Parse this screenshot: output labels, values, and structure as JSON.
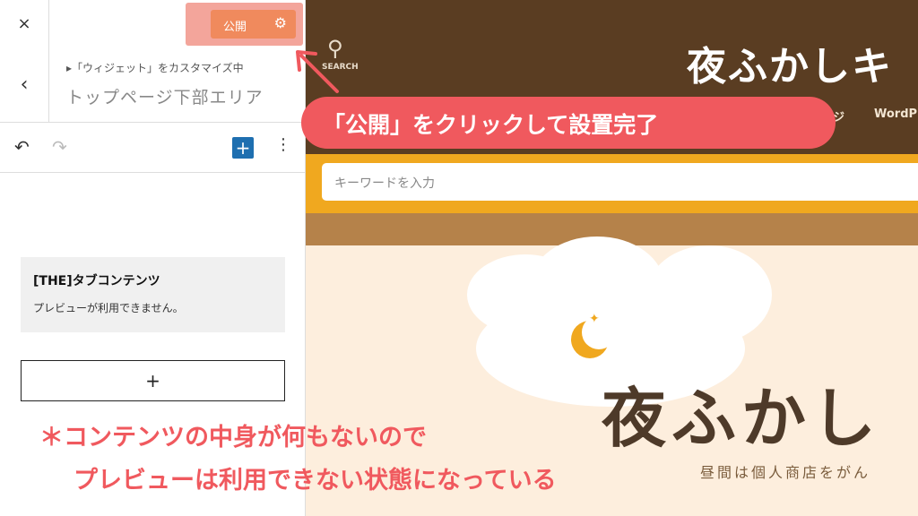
{
  "panel": {
    "close_icon": "×",
    "publish_label": "公開",
    "gear_icon": "⚙",
    "back_icon": "‹",
    "breadcrumb_sub": "▸「ウィジェット」をカスタマイズ中",
    "breadcrumb_title": "トップページ下部エリア",
    "undo_icon": "↶",
    "redo_icon": "↷",
    "add_icon": "+",
    "more_icon": "⋮",
    "widget_title": "[THE]タブコンテンツ",
    "widget_message": "プレビューが利用できません。",
    "add_block_icon": "+"
  },
  "preview": {
    "search_icon": "⚲",
    "search_label": "SEARCH",
    "site_title": "夜ふかしキ",
    "nav_items": [
      "ジ",
      "WordP"
    ],
    "search_placeholder": "キーワードを入力",
    "hero_title": "夜ふかし",
    "hero_subtitle": "昼間は個人商店をがん"
  },
  "annotations": {
    "callout": "「公開」をクリックして設置完了",
    "note_line1": "＊コンテンツの中身が何もないので",
    "note_line2": "プレビューは利用できない状態になっている"
  },
  "colors": {
    "publish": "#f08a5d",
    "callout": "#f0595e",
    "site_header": "#5a3d22",
    "search_band": "#f0a81f",
    "hero_bg": "#fdeedd"
  }
}
